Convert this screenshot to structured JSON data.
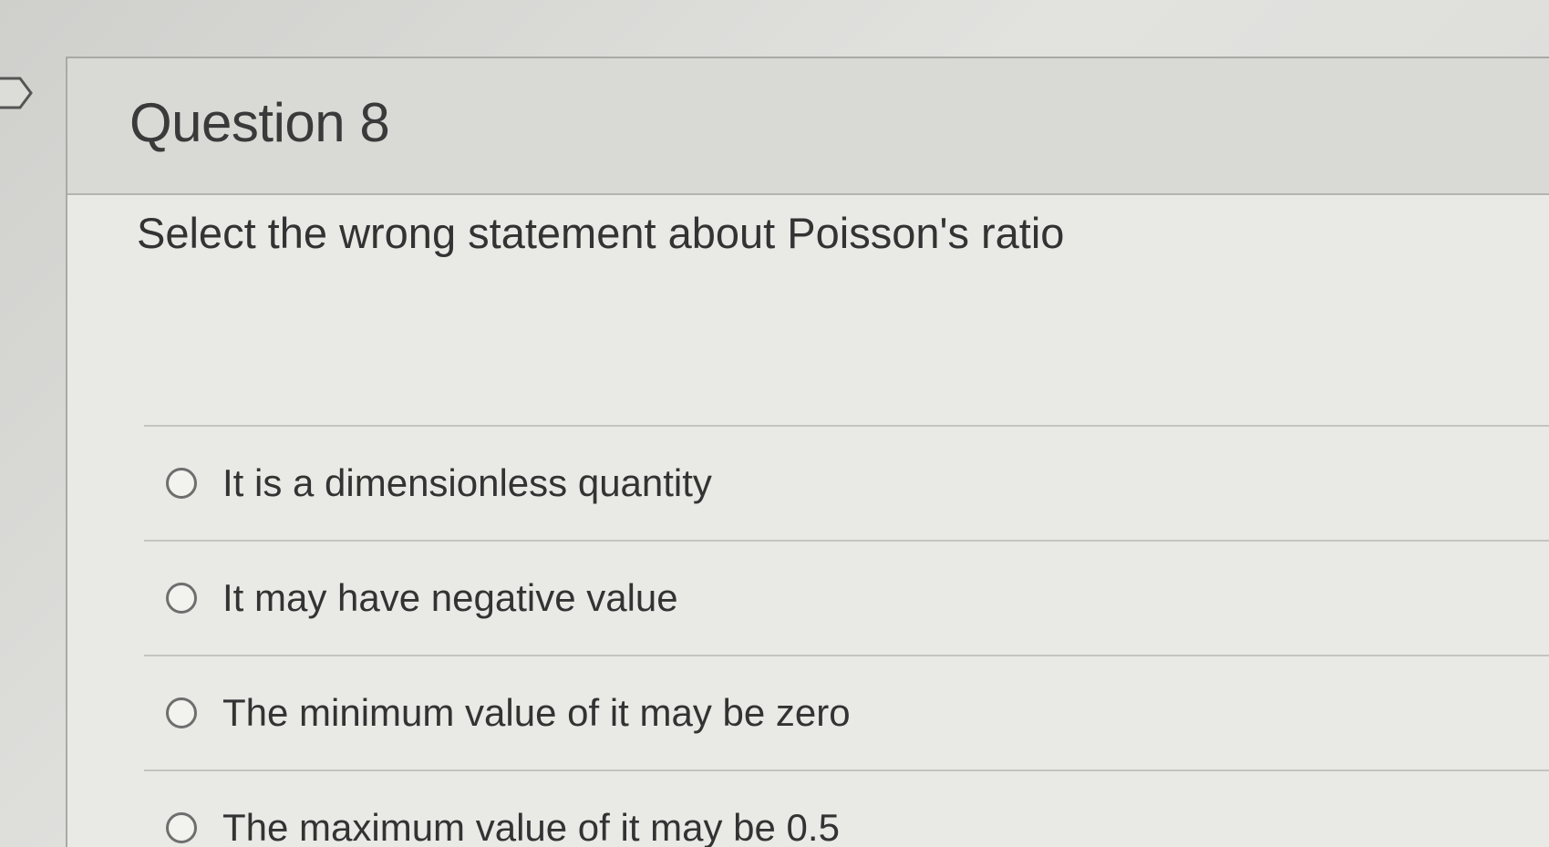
{
  "question": {
    "title": "Question 8",
    "text": "Select the wrong statement about Poisson's ratio",
    "answers": [
      {
        "label": "It is a dimensionless quantity",
        "selected": false
      },
      {
        "label": "It may have negative value",
        "selected": false
      },
      {
        "label": "The minimum value of it may be zero",
        "selected": false
      },
      {
        "label": "The maximum value of it may be 0.5",
        "selected": false
      }
    ]
  },
  "icons": {
    "flag": "flag-marker-icon",
    "radio": "radio-button-icon"
  },
  "colors": {
    "text": "#333333",
    "header_bg": "#d9d9d6",
    "divider": "#c4c4c1"
  }
}
